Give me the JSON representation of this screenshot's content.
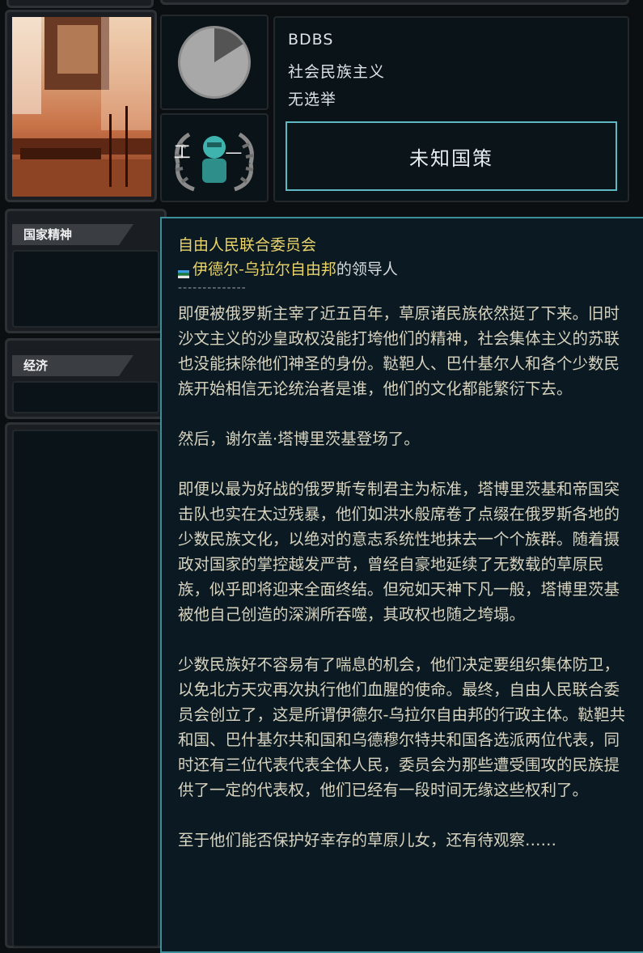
{
  "party": {
    "name": "BDBS",
    "ideology": "社会民族主义",
    "election": "无选举"
  },
  "focus_button": {
    "label": "未知国策"
  },
  "ideology_pie": {
    "share_main": 0.84,
    "color_main": "#a8a8a8",
    "color_minor": "#545454"
  },
  "party_icon": {
    "label": "工 —"
  },
  "sections": {
    "national_spirit": "国家精神",
    "economy": "经济"
  },
  "tooltip": {
    "title": "自由人民联合委员会",
    "country": "伊德尔-乌拉尔自由邦",
    "subtitle_suffix": "的领导人",
    "separator": "--------------",
    "body": "即便被俄罗斯主宰了近五百年，草原诸民族依然挺了下来。旧时沙文主义的沙皇政权没能打垮他们的精神，社会集体主义的苏联也没能抹除他们神圣的身份。鞑靼人、巴什基尔人和各个少数民族开始相信无论统治者是谁，他们的文化都能繁衍下去。\n\n然后，谢尔盖·塔博里茨基登场了。\n\n即便以最为好战的俄罗斯专制君主为标准，塔博里茨基和帝国突击队也实在太过残暴，他们如洪水般席卷了点缀在俄罗斯各地的少数民族文化，以绝对的意志系统性地抹去一个个族群。随着摄政对国家的掌控越发严苛，曾经自豪地延续了无数载的草原民族，似乎即将迎来全面终结。但宛如天神下凡一般，塔博里茨基被他自己创造的深渊所吞噬，其政权也随之垮塌。\n\n少数民族好不容易有了喘息的机会，他们决定要组织集体防卫，以免北方天灾再次执行他们血腥的使命。最终，自由人民联合委员会创立了，这是所谓伊德尔-乌拉尔自由邦的行政主体。鞑靼共和国、巴什基尔共和国和乌德穆尔特共和国各选派两位代表，同时还有三位代表代表全体人民，委员会为那些遭受围攻的民族提供了一定的代表权，他们已经有一段时间无缘这些权利了。\n\n至于他们能否保护好幸存的草原儿女，还有待观察……",
    "title_color": "#e9d36a",
    "border_color": "#3c8e98"
  }
}
